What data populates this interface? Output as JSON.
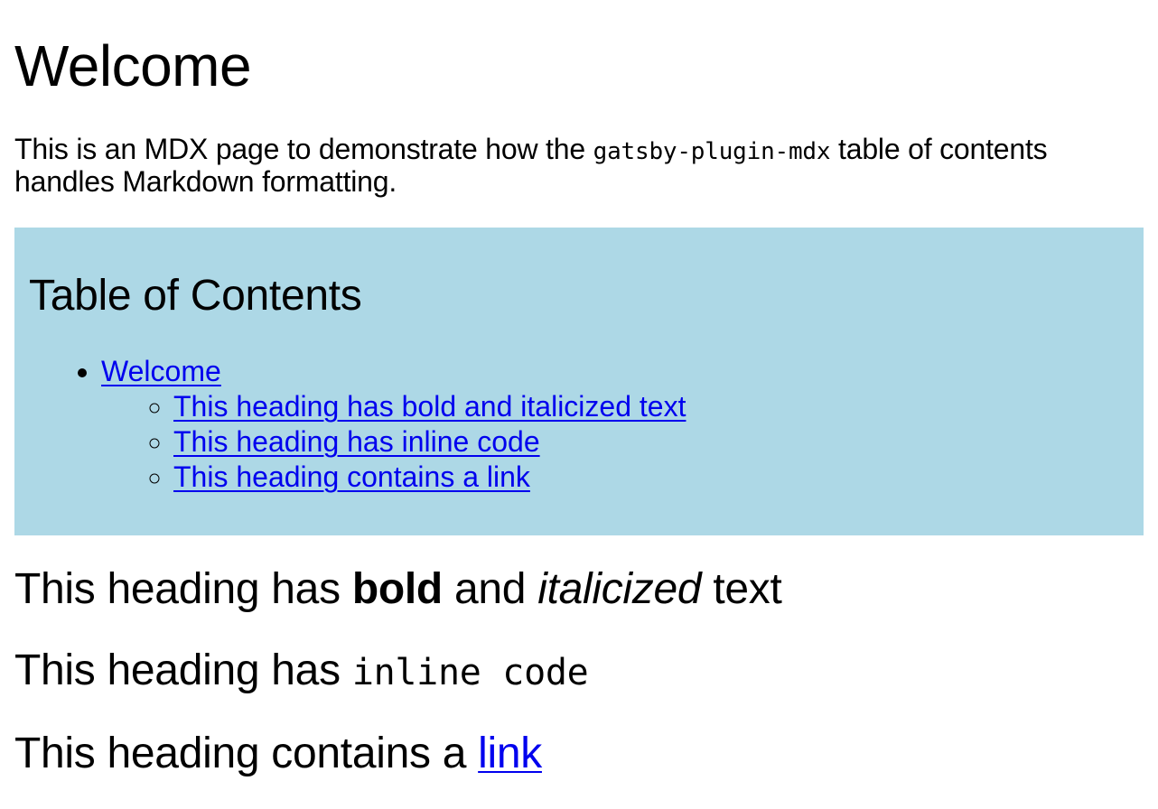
{
  "page": {
    "title": "Welcome",
    "intro": {
      "before_code": "This is an MDX page to demonstrate how the ",
      "code": "gatsby-plugin-mdx",
      "after_code": " table of contents handles Markdown formatting."
    }
  },
  "toc": {
    "heading": "Table of Contents",
    "background": "#add8e6",
    "link_color": "#0000ee",
    "top_item": "Welcome",
    "sub_items": [
      "This heading has bold and italicized text",
      "This heading has inline code",
      "This heading contains a link"
    ]
  },
  "sections": {
    "bold_italic": {
      "prefix": "This heading has ",
      "bold": "bold",
      "middle": " and ",
      "italic": "italicized",
      "suffix": " text"
    },
    "inline_code": {
      "prefix": "This heading has ",
      "code": "inline code"
    },
    "link": {
      "prefix": "This heading contains a ",
      "link_text": "link"
    }
  }
}
